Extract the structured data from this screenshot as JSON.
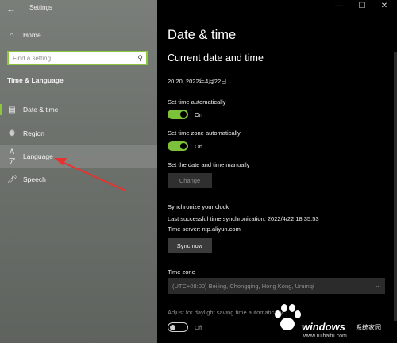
{
  "window": {
    "app_title": "Settings",
    "controls": {
      "minimize": "—",
      "maximize": "☐",
      "close": "✕"
    }
  },
  "sidebar": {
    "home": "Home",
    "search_placeholder": "Find a setting",
    "section_title": "Time & Language",
    "items": [
      {
        "label": "Date & time",
        "icon": "calendar-clock-icon",
        "selected": true
      },
      {
        "label": "Region",
        "icon": "globe-icon",
        "selected": false
      },
      {
        "label": "Language",
        "icon": "language-icon",
        "selected": false,
        "hovered": true
      },
      {
        "label": "Speech",
        "icon": "microphone-icon",
        "selected": false
      }
    ],
    "accent": "#8dc63f"
  },
  "main": {
    "title": "Date & time",
    "section": "Current date and time",
    "current_datetime": "20:20, 2022年4月22日",
    "set_time_auto": {
      "label": "Set time automatically",
      "state": "On"
    },
    "set_timezone_auto": {
      "label": "Set time zone automatically",
      "state": "On"
    },
    "manual": {
      "label": "Set the date and time manually",
      "button": "Change"
    },
    "sync": {
      "title": "Synchronize your clock",
      "last_sync": "Last successful time synchronization: 2022/4/22 18:35:53",
      "server": "Time server: ntp.aliyun.com",
      "button": "Sync now"
    },
    "time_zone": {
      "label": "Time zone",
      "value": "(UTC+08:00) Beijing, Chongqing, Hong Kong, Urumqi"
    },
    "daylight": {
      "label": "Adjust for daylight saving time automatically",
      "state": "Off"
    }
  },
  "watermark": {
    "brand": "windows",
    "brand_cn": "系统家园",
    "url": "www.ruihaitu.com"
  }
}
